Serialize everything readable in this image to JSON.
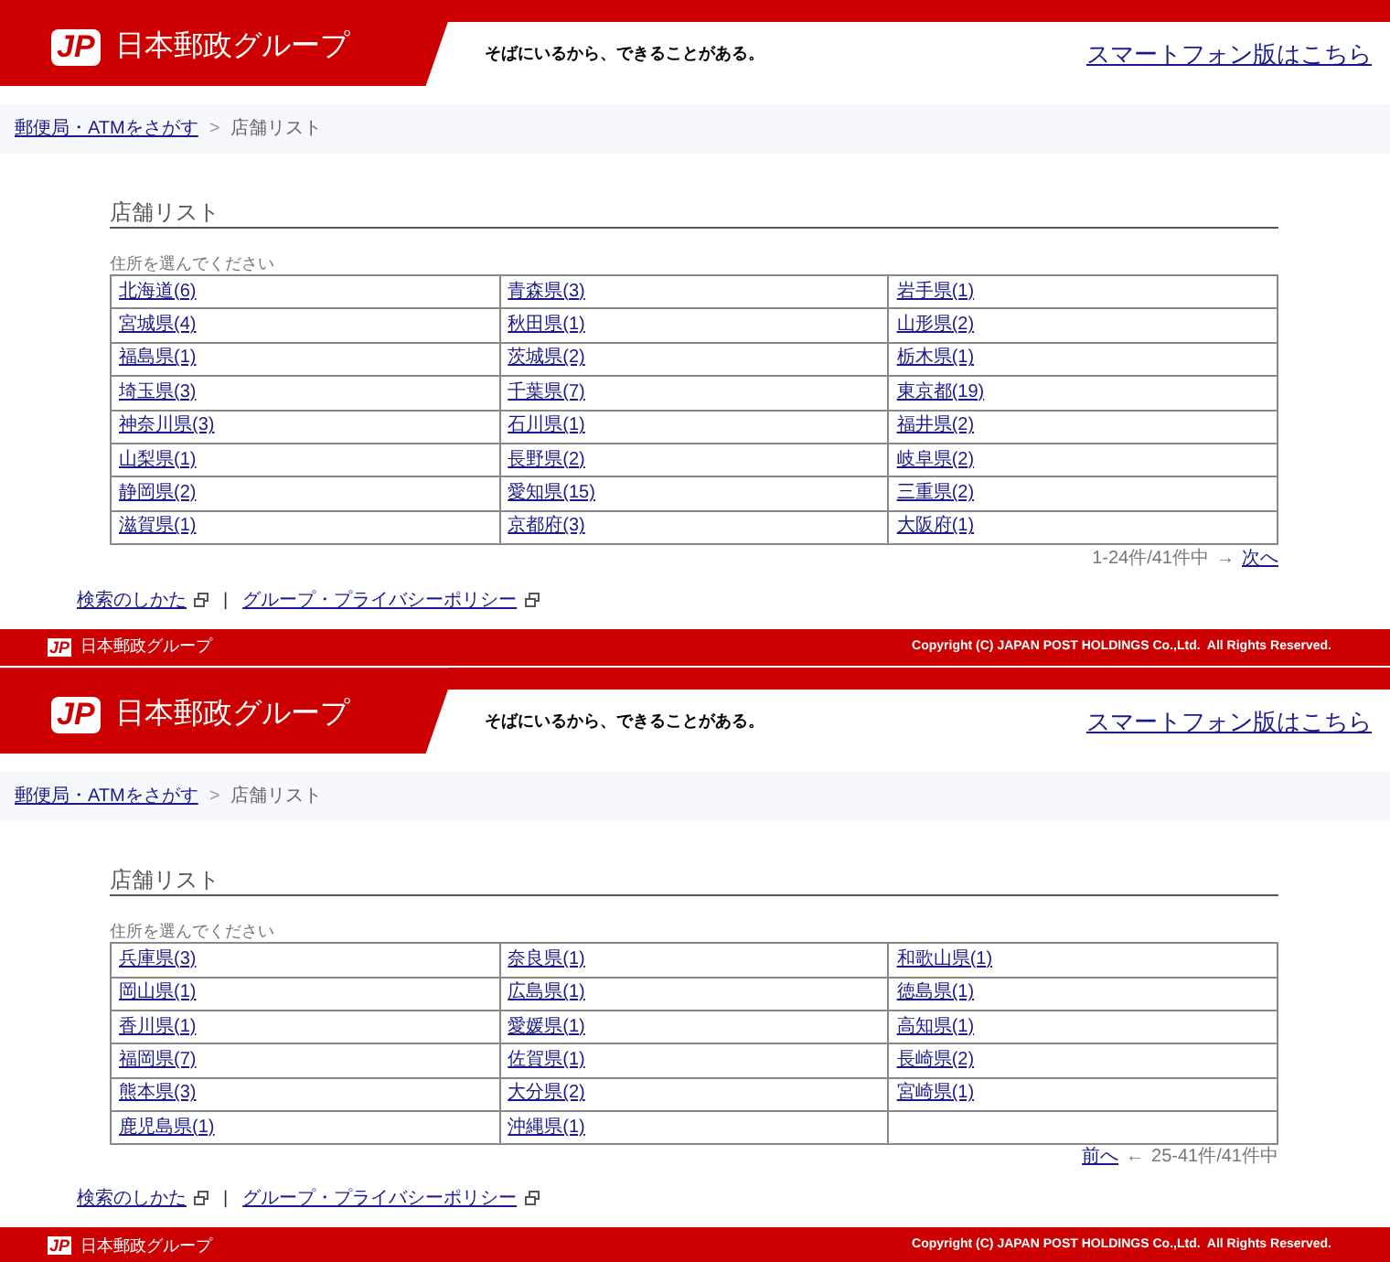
{
  "pages": [
    {
      "header": {
        "logo_mark": "JP",
        "logo": "日本郵政グループ",
        "tagline": "そばにいるから、できることがある。",
        "smartphone_link": "スマートフォン版はこちら"
      },
      "breadcrumb": {
        "link": "郵便局・ATMをさがす",
        "separator": ">",
        "current": "店舗リスト"
      },
      "heading": "店舗リスト",
      "caption": "住所を選んでください",
      "rows": [
        [
          "北海道(6)",
          "青森県(3)",
          "岩手県(1)"
        ],
        [
          "宮城県(4)",
          "秋田県(1)",
          "山形県(2)"
        ],
        [
          "福島県(1)",
          "茨城県(2)",
          "栃木県(1)"
        ],
        [
          "埼玉県(3)",
          "千葉県(7)",
          "東京都(19)"
        ],
        [
          "神奈川県(3)",
          "石川県(1)",
          "福井県(2)"
        ],
        [
          "山梨県(1)",
          "長野県(2)",
          "岐阜県(2)"
        ],
        [
          "静岡県(2)",
          "愛知県(15)",
          "三重県(2)"
        ],
        [
          "滋賀県(1)",
          "京都府(3)",
          "大阪府(1)"
        ]
      ],
      "pager": {
        "kind": "next",
        "range": "1-24件/41件中",
        "arrow": "→",
        "link": "次へ"
      },
      "footer_links": [
        "検索のしかた",
        "グループ・プライバシーポリシー"
      ],
      "link_separator": "|",
      "footer": {
        "logo_mark": "JP",
        "logo": "日本郵政グループ",
        "copyright": "Copyright (C) JAPAN POST HOLDINGS Co.,Ltd.  All Rights Reserved."
      }
    },
    {
      "header": {
        "logo_mark": "JP",
        "logo": "日本郵政グループ",
        "tagline": "そばにいるから、できることがある。",
        "smartphone_link": "スマートフォン版はこちら"
      },
      "breadcrumb": {
        "link": "郵便局・ATMをさがす",
        "separator": ">",
        "current": "店舗リスト"
      },
      "heading": "店舗リスト",
      "caption": "住所を選んでください",
      "rows": [
        [
          "兵庫県(3)",
          "奈良県(1)",
          "和歌山県(1)"
        ],
        [
          "岡山県(1)",
          "広島県(1)",
          "徳島県(1)"
        ],
        [
          "香川県(1)",
          "愛媛県(1)",
          "高知県(1)"
        ],
        [
          "福岡県(7)",
          "佐賀県(1)",
          "長崎県(2)"
        ],
        [
          "熊本県(3)",
          "大分県(2)",
          "宮崎県(1)"
        ],
        [
          "鹿児島県(1)",
          "沖縄県(1)"
        ]
      ],
      "pager": {
        "kind": "prev",
        "range": "25-41件/41件中",
        "arrow": "←",
        "link": "前へ"
      },
      "footer_links": [
        "検索のしかた",
        "グループ・プライバシーポリシー"
      ],
      "link_separator": "|",
      "footer": {
        "logo_mark": "JP",
        "logo": "日本郵政グループ",
        "copyright": "Copyright (C) JAPAN POST HOLDINGS Co.,Ltd.  All Rights Reserved."
      }
    }
  ]
}
